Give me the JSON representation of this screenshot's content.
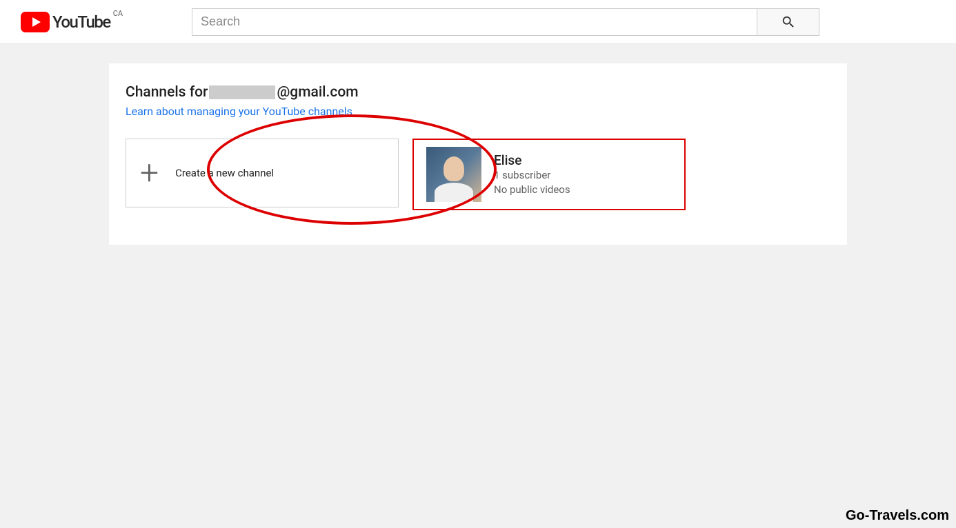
{
  "header": {
    "logo_text": "YouTube",
    "country_code": "CA",
    "search_placeholder": "Search"
  },
  "page": {
    "title_prefix": "Channels for ",
    "title_suffix": "@gmail.com",
    "learn_link": "Learn about managing your YouTube channels"
  },
  "create_card": {
    "label": "Create a new channel"
  },
  "channel": {
    "name": "Elise",
    "subscribers": "1 subscriber",
    "videos": "No public videos"
  },
  "watermark": "Go-Travels.com"
}
